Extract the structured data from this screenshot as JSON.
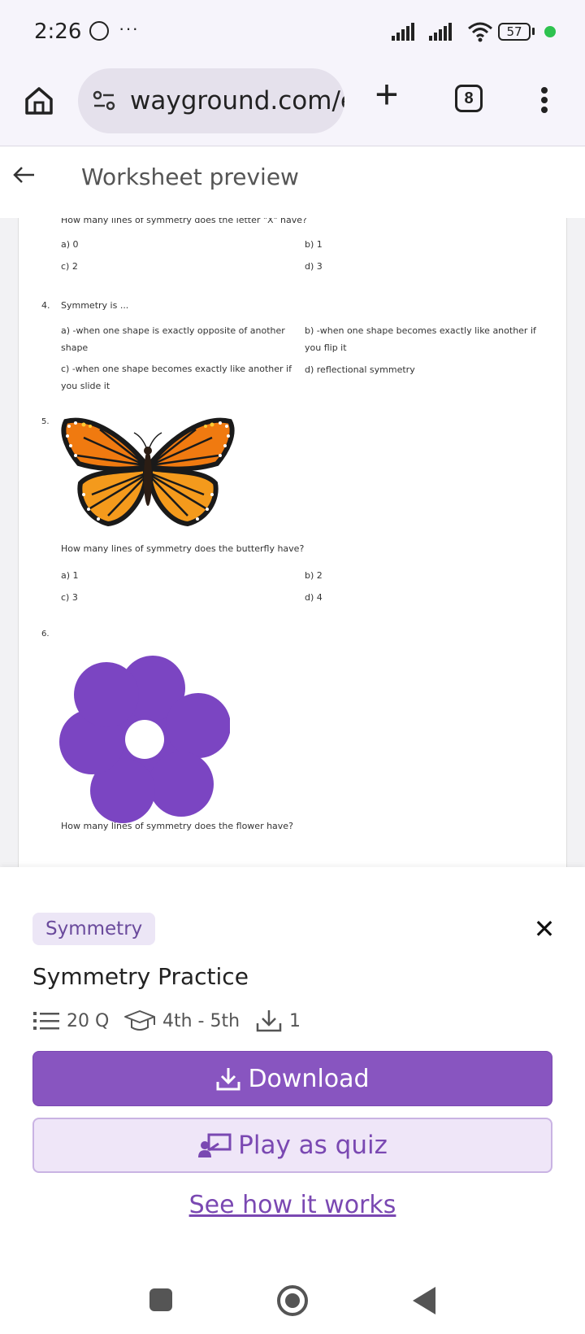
{
  "status": {
    "time": "2:26",
    "dots": "···",
    "battery": "57"
  },
  "browser": {
    "url": "wayground.com/e",
    "tab_count": "8"
  },
  "header": {
    "title": "Worksheet preview"
  },
  "worksheet": {
    "q3": {
      "text": "How many lines of symmetry does the letter \"X\" have?",
      "a": "a)  0",
      "b": "b)  1",
      "c": "c)  2",
      "d": "d)  3"
    },
    "q4": {
      "num": "4.",
      "text": "Symmetry is ...",
      "a": "a)  -when one shape is exactly opposite of another shape",
      "b": "b)  -when one shape becomes exactly like another if you flip it",
      "c": "c)  -when one shape becomes exactly like another if you slide it",
      "d": "d)  reflectional symmetry"
    },
    "q5": {
      "num": "5.",
      "text": "How many lines of symmetry does the butterfly have?",
      "a": "a)  1",
      "b": "b)  2",
      "c": "c)  3",
      "d": "d)  4"
    },
    "q6": {
      "num": "6.",
      "text": "How many lines of symmetry does the flower have?"
    }
  },
  "panel": {
    "tag": "Symmetry",
    "title": "Symmetry Practice",
    "questions": "20 Q",
    "grade": "4th - 5th",
    "downloads": "1",
    "download_label": "Download",
    "play_label": "Play as quiz",
    "see_how_label": "See how it works"
  },
  "colors": {
    "accent": "#8855c0",
    "accent_light": "#efe6f8",
    "flower": "#7b45c2",
    "butterfly_orange": "#f07a10"
  }
}
